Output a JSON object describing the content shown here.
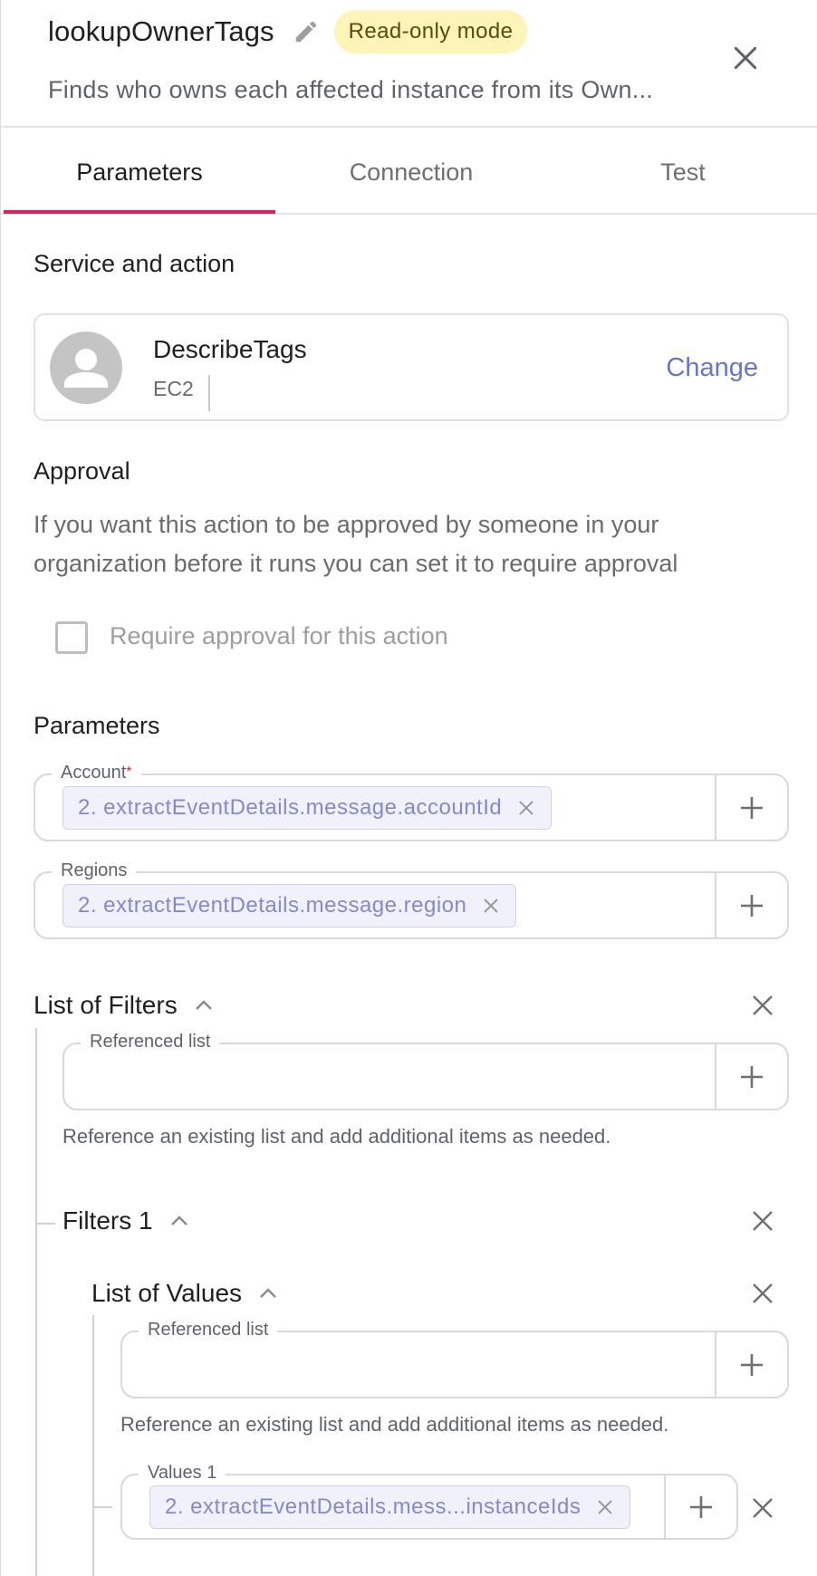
{
  "header": {
    "title": "lookupOwnerTags",
    "badge": "Read-only mode",
    "subtitle": "Finds who owns each affected instance from its Own..."
  },
  "tabs": [
    {
      "label": "Parameters",
      "active": true
    },
    {
      "label": "Connection",
      "active": false
    },
    {
      "label": "Test",
      "active": false
    }
  ],
  "service": {
    "section_title": "Service and action",
    "action_name": "DescribeTags",
    "service_name": "EC2",
    "change_label": "Change"
  },
  "approval": {
    "section_title": "Approval",
    "description": "If you want this action to be approved by someone in your organization before it runs you can set it to require approval",
    "checkbox_label": "Require approval for this action",
    "checked": false
  },
  "parameters": {
    "section_title": "Parameters",
    "account": {
      "label": "Account",
      "required_mark": "*",
      "chip": "2. extractEventDetails.message.accountId"
    },
    "regions": {
      "label": "Regions",
      "chip": "2. extractEventDetails.message.region"
    },
    "list_of_filters": {
      "title": "List of Filters",
      "referenced_list_label": "Referenced list",
      "help": "Reference an existing list and add additional items as needed.",
      "filters_1": {
        "title": "Filters 1",
        "list_of_values": {
          "title": "List of Values",
          "referenced_list_label": "Referenced list",
          "help": "Reference an existing list and add additional items as needed.",
          "values_1": {
            "label": "Values 1",
            "chip": "2. extractEventDetails.mess...instanceIds"
          }
        }
      }
    }
  },
  "colors": {
    "accent_tab": "#d6245a",
    "link": "#6a74c9",
    "badge_bg": "#fdf4b8",
    "chip_text": "#8489cf"
  }
}
